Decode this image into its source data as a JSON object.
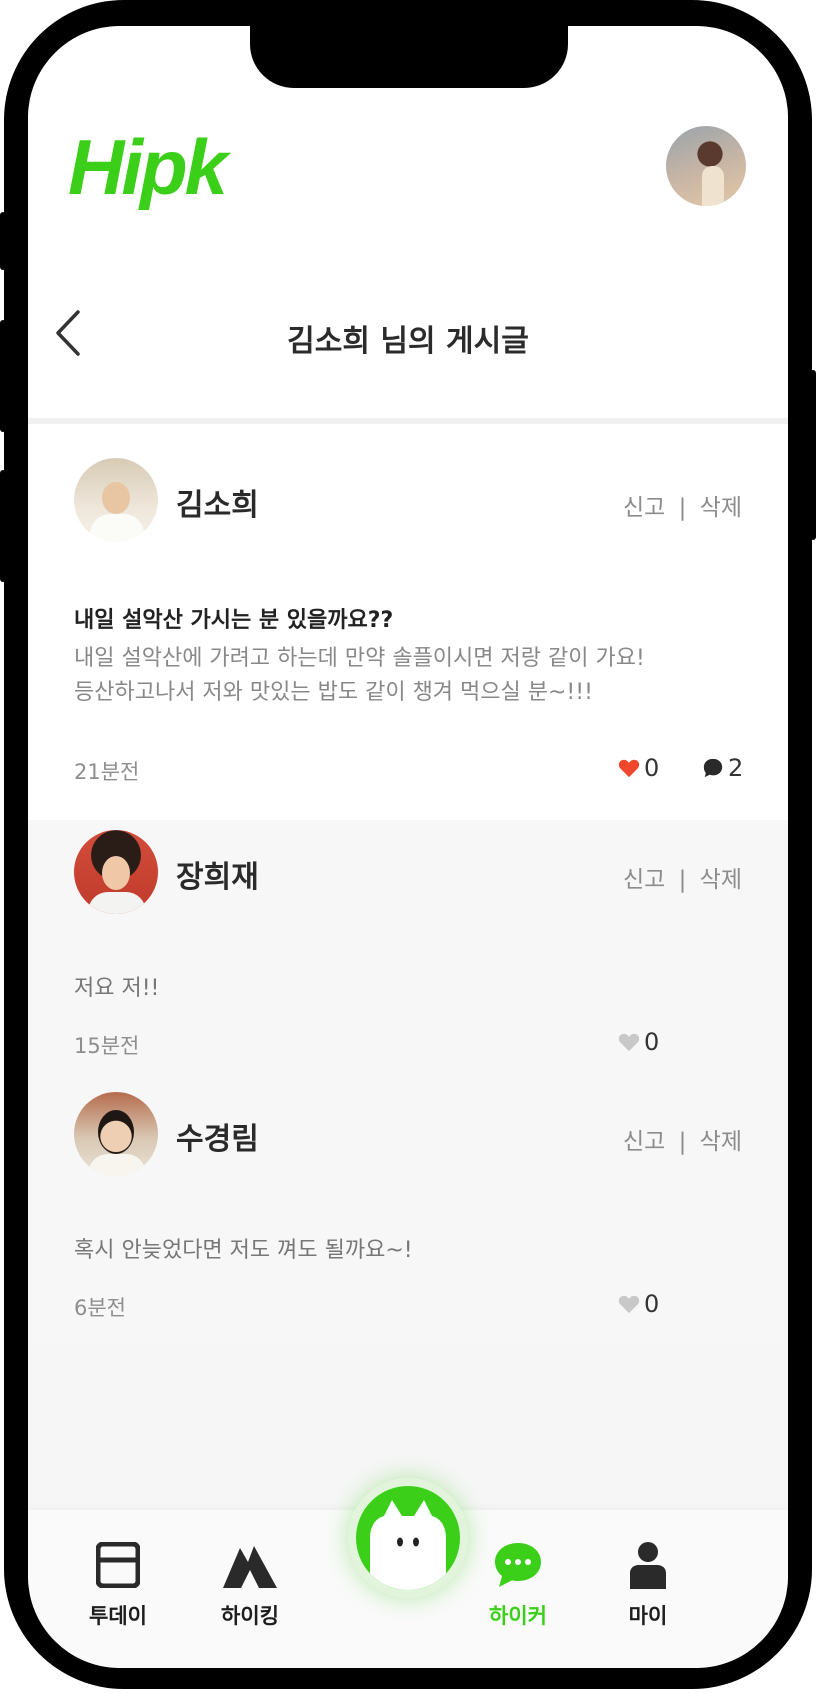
{
  "header": {
    "logo": "Hipk",
    "title": "김소희 님의 게시글"
  },
  "post": {
    "author": "김소희",
    "report_label": "신고",
    "separator": "|",
    "delete_label": "삭제",
    "title": "내일 설악산 가시는 분 있을까요??",
    "body_line1": "내일 설악산에 가려고 하는데 만약 솔플이시면 저랑 같이 가요!",
    "body_line2": "등산하고나서 저와 맛있는 밥도 같이 챙겨 먹으실 분~!!!",
    "time": "21분전",
    "likes": "0",
    "comments": "2"
  },
  "comments": [
    {
      "author": "장희재",
      "text": "저요 저!!",
      "time": "15분전",
      "likes": "0"
    },
    {
      "author": "수경림",
      "text": "혹시 안늦었다면 저도 껴도 될까요~!",
      "time": "6분전",
      "likes": "0"
    }
  ],
  "nav": {
    "items": [
      {
        "label": "투데이",
        "icon": "calendar-icon"
      },
      {
        "label": "하이킹",
        "icon": "mountain-icon"
      },
      {
        "label": "하이커",
        "icon": "chat-bubble-icon"
      },
      {
        "label": "마이",
        "icon": "person-icon"
      }
    ],
    "active_color": "#3ccf1a"
  },
  "colors": {
    "brand": "#3ccf1a",
    "like_active": "#f0462c",
    "like_inactive": "#c8c8c8"
  }
}
